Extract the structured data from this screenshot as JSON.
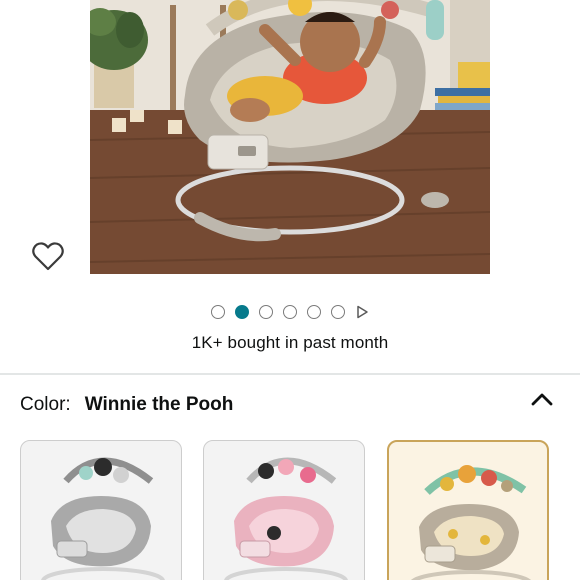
{
  "product": {
    "image_alt": "baby-bouncer-photo",
    "carousel": {
      "total_dots": 6,
      "active_index": 1
    },
    "bought_text": "1K+ bought in past month"
  },
  "variation": {
    "label": "Color:",
    "selected_value": "Winnie the Pooh",
    "options": [
      {
        "id": "grey-mickey",
        "selected": false
      },
      {
        "id": "pink-minnie",
        "selected": false
      },
      {
        "id": "winnie-the-pooh",
        "selected": true
      }
    ]
  },
  "icons": {
    "wishlist": "heart-outline-icon",
    "carousel_video": "play-triangle-icon",
    "collapse": "chevron-up-icon"
  },
  "colors": {
    "active_dot": "#077a8c",
    "selected_swatch_border": "#c9a45a",
    "text": "#0f1111"
  }
}
